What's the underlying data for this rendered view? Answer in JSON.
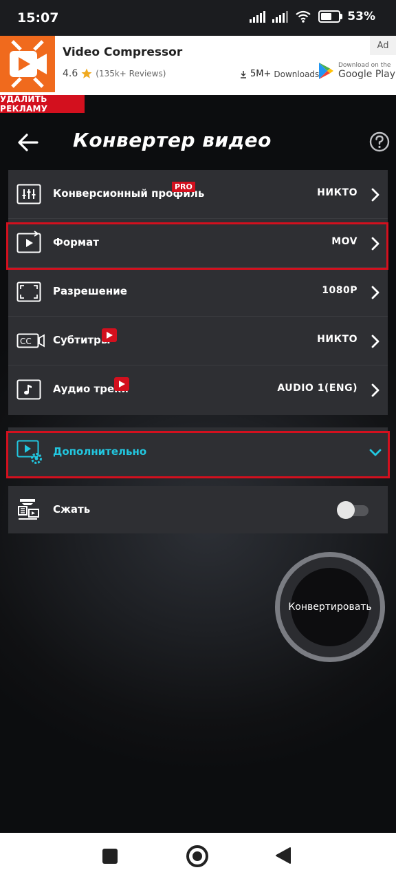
{
  "status_bar": {
    "time": "15:07",
    "battery_percent": "53%",
    "battery_level": 0.53
  },
  "ad": {
    "title": "Video Compressor",
    "rating": "4.6",
    "reviews": "(135k+ Reviews)",
    "downloads_count": "5M+",
    "downloads_label": "Downloads",
    "store_small": "Download on the",
    "store_big": "Google Play",
    "ad_label": "Ad",
    "remove_ad": "УДАЛИТЬ РЕКЛАМУ"
  },
  "header": {
    "title": "Конвертер видео"
  },
  "settings": [
    {
      "label": "Конверсионный профиль",
      "value": "НИКТО",
      "badge": "PRO",
      "icon": "sliders-icon"
    },
    {
      "label": "Формат",
      "value": "MOV",
      "icon": "video-format-icon"
    },
    {
      "label": "Разрешение",
      "value": "1080P",
      "icon": "resolution-icon"
    },
    {
      "label": "Субтитры",
      "value": "НИКТО",
      "icon": "subtitles-icon",
      "video_badge": true
    },
    {
      "label": "Аудио треки",
      "value": "AUDIO 1(ENG)",
      "icon": "music-note-icon",
      "video_badge": true
    }
  ],
  "advanced": {
    "label": "Дополнительно",
    "icon": "video-settings-icon"
  },
  "compress": {
    "label": "Сжать",
    "enabled": false,
    "icon": "compress-icon"
  },
  "convert_button": "Конвертировать",
  "colors": {
    "accent": "#22c7e0",
    "highlight": "#d3101e",
    "card": "#2e2f33",
    "ad_brand": "#f06a1d"
  }
}
